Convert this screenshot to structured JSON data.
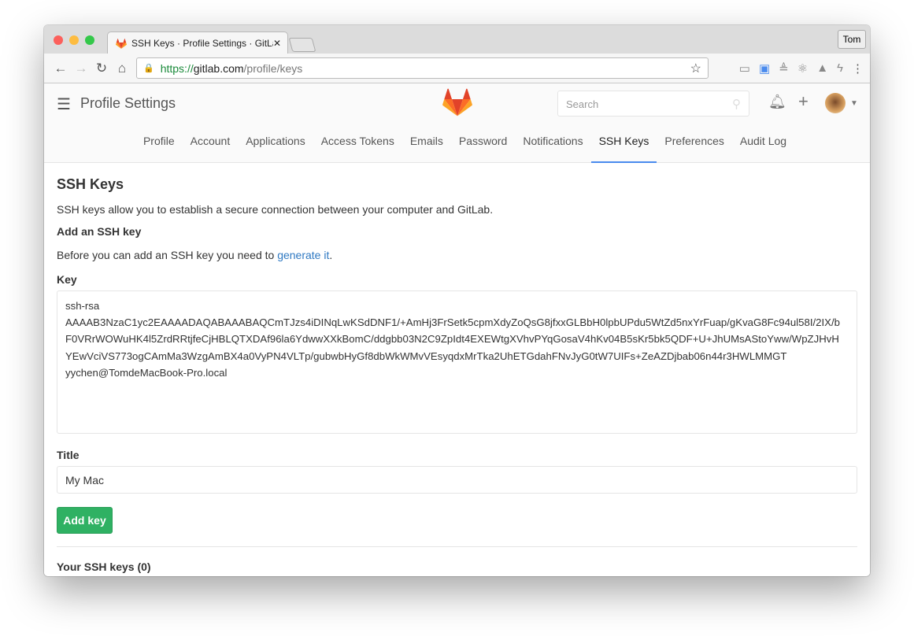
{
  "browser": {
    "tab_title": "SSH Keys · Profile Settings · GitLab",
    "url_scheme": "https://",
    "url_host": "gitlab.com",
    "url_path": "/profile/keys",
    "profile_button": "Tom",
    "traffic_colors": [
      "#fc605c",
      "#fdbc40",
      "#34c84a"
    ]
  },
  "header": {
    "title": "Profile Settings",
    "search_placeholder": "Search"
  },
  "nav": {
    "items": [
      "Profile",
      "Account",
      "Applications",
      "Access Tokens",
      "Emails",
      "Password",
      "Notifications",
      "SSH Keys",
      "Preferences",
      "Audit Log"
    ],
    "active": "SSH Keys"
  },
  "page": {
    "heading": "SSH Keys",
    "description": "SSH keys allow you to establish a secure connection between your computer and GitLab.",
    "add_heading": "Add an SSH key",
    "before_text": "Before you can add an SSH key you need to ",
    "generate_link": "generate it",
    "period": ".",
    "key_label": "Key",
    "key_lines": [
      "ssh-rsa",
      "AAAAB3NzaC1yc2EAAAADAQABAAABAQCmTJzs4iDINqLwKSdDNF1/+AmHj3FrSetk5cpmXdyZoQsG8jfxxGLBbH0lpbUPdu5WtZd5nxYrFuap/gKvaG8Fc94ul58I/2IX/b",
      "F0VRrWOWuHK4l5ZrdRRtjfeCjHBLQTXDAf96la6YdwwXXkBomC/ddgbb03N2C9ZpIdt4EXEWtgXVhvPYqGosaV4hKv04B5sKr5bk5QDF+U+JhUMsAStoYww/WpZJHvH",
      "YEwVciVS773ogCAmMa3WzgAmBX4a0VyPN4VLTp/gubwbHyGf8dbWkWMvVEsyqdxMrTka2UhETGdahFNvJyG0tW7UIFs+ZeAZDjbab06n44r3HWLMMGT",
      "yychen@TomdeMacBook-Pro.local"
    ],
    "title_label": "Title",
    "title_value": "My Mac",
    "add_button": "Add key",
    "your_keys": "Your SSH keys (0)"
  }
}
